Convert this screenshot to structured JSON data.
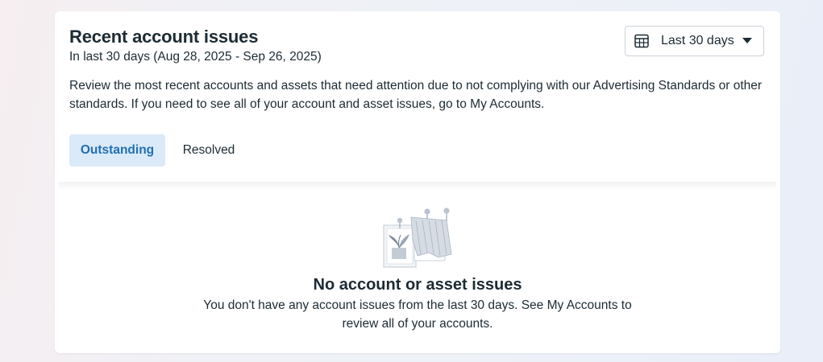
{
  "panel": {
    "title": "Recent account issues",
    "subtitle": "In last 30 days (Aug 28, 2025 - Sep 26, 2025)",
    "description": "Review the most recent accounts and assets that need attention due to not complying with our Advertising Standards or other standards. If you need to see all of your account and asset issues, go to My Accounts.",
    "date_range": {
      "label": "Last 30 days",
      "icon": "calendar-icon"
    },
    "tabs": [
      {
        "label": "Outstanding",
        "active": true
      },
      {
        "label": "Resolved",
        "active": false
      }
    ]
  },
  "empty_state": {
    "illustration": "empty-board-illustration",
    "title": "No account or asset issues",
    "message": "You don't have any account issues from the last 30 days. See My Accounts to review all of your accounts."
  },
  "colors": {
    "accent": "#1f6fb5",
    "active_tab_bg": "#dbeaf8",
    "text": "#1c2b33",
    "border": "#cbd2d9"
  }
}
